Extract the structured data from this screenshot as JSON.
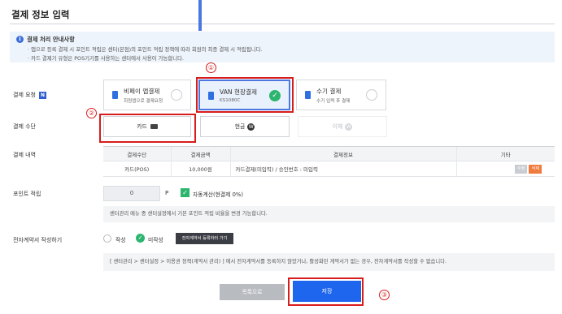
{
  "page": {
    "title": "결제 정보 입력"
  },
  "notice": {
    "icon": "info-icon",
    "title": "결제 처리 안내사항",
    "lines": [
      "· 앱으로 등록 결제 시 포인트 적립은 센터(본점)의 포인트 적립 정책에 따라 회원의 최종 결제 시 적립됩니다.",
      "· 카드 결제기 유형은 POS기기를 사용하는 센터에서 사용이 가능합니다."
    ]
  },
  "payment_request": {
    "label": "결제 요청",
    "badge": "N",
    "options": [
      {
        "title": "비페이 앱결제",
        "sub": "회원앱으로 결제요청",
        "icon": "phone-icon",
        "selected": false
      },
      {
        "title": "VAN 현장결제",
        "sub": "KS1080C",
        "icon": "terminal-icon",
        "selected": true
      },
      {
        "title": "수기 결제",
        "sub": "수기 입력 후 결제",
        "icon": "document-icon",
        "selected": false
      }
    ]
  },
  "payment_method": {
    "label": "결제 수단",
    "options": [
      {
        "label": "카드",
        "icon": "credit-card-icon",
        "state": "selected"
      },
      {
        "label": "현금",
        "icon": "won-coin-icon",
        "state": "normal"
      },
      {
        "label": "이체",
        "icon": "won-coin-icon",
        "state": "disabled"
      }
    ]
  },
  "payment_detail": {
    "label": "결제 내역",
    "columns": [
      "결제수단",
      "결제금액",
      "결제정보",
      "기타"
    ],
    "rows": [
      {
        "method": "카드(POS)",
        "amount": "10,000원",
        "info": "카드결제(미입력) / 승인번호 : 미입력",
        "btn_edit": "수정",
        "btn_delete": "삭제"
      }
    ]
  },
  "point": {
    "label": "포인트 적립",
    "value": "0",
    "unit": "P",
    "auto_label": "자동계산(현결제 0%)",
    "auto_checked": true,
    "help": "센터관리 메뉴 중 센터설정에서 기본 포인트 적립 비율을 변경 가능합니다."
  },
  "contract": {
    "label": "전자계약서 작성하기",
    "options": [
      {
        "label": "작성",
        "checked": false
      },
      {
        "label": "미작성",
        "checked": true
      }
    ],
    "register_button": "전자계약서 등록하러 가기",
    "help": "[ 센터관리 > 센터설정 > 이용권 정책(계약서 관리) ] 에서 전자계약서를 등록하지 않았거나, 활성화된 계약서가 없는 경우, 전자계약서를 작성할 수 없습니다."
  },
  "actions": {
    "list": "목록으로",
    "save": "저장"
  },
  "annotations": [
    "①",
    "②",
    "③"
  ],
  "colors": {
    "primary": "#1f66ee",
    "accent_green": "#2db56f",
    "highlight_red": "#d81c1c",
    "notice_bg": "#eef4fb"
  }
}
